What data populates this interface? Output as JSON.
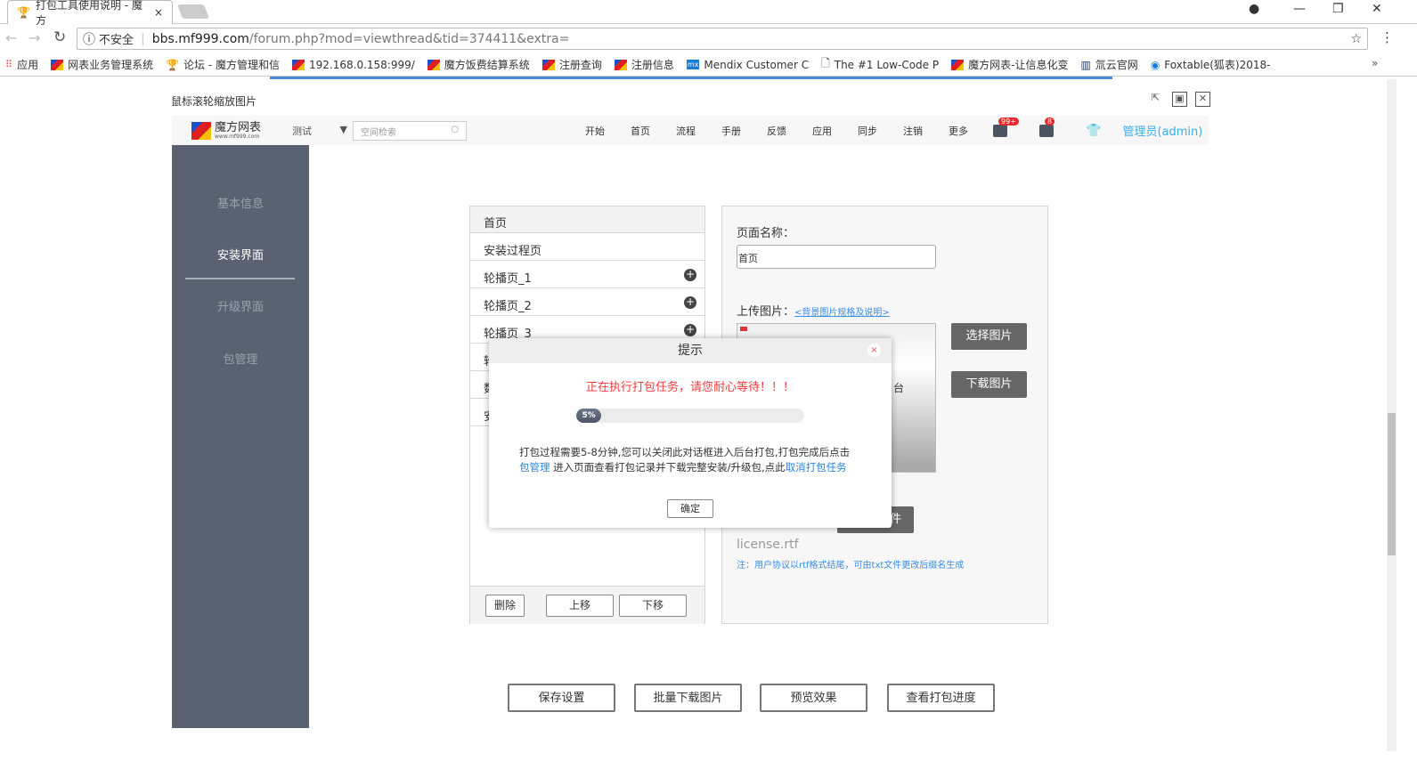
{
  "browser": {
    "tab_title": "打包工具使用说明 - 魔方",
    "security_label": "不安全",
    "url_domain": "bbs.mf999.com",
    "url_path": "/forum.php?mod=viewthread&tid=374411&extra=",
    "bookmarks": [
      "应用",
      "网表业务管理系统",
      "论坛 - 魔方管理和信",
      "192.168.0.158:999/",
      "魔方饭费结算系统",
      "注册查询",
      "注册信息",
      "Mendix Customer C",
      "The #1 Low-Code P",
      "魔方网表-让信息化变",
      "氚云官网",
      "Foxtable(狐表)2018-"
    ],
    "more": "»"
  },
  "page": {
    "hint": "鼠标滚轮缩放图片",
    "header": {
      "logo_title": "魔方网表",
      "logo_sub": "www.mf999.com",
      "select_value": "测试",
      "search_placeholder": "空间检索",
      "nav": [
        "开始",
        "首页",
        "流程",
        "手册",
        "反馈",
        "应用",
        "同步",
        "注销",
        "更多"
      ],
      "msg_badge": "99+",
      "task_badge": "8",
      "user": "管理员(admin)"
    },
    "sidebar": [
      {
        "label": "基本信息",
        "active": false
      },
      {
        "label": "安装界面",
        "active": true
      },
      {
        "label": "升级界面",
        "active": false
      },
      {
        "label": "包管理",
        "active": false
      }
    ],
    "list": {
      "header": "首页",
      "items": [
        "安装过程页",
        "轮播页_1",
        "轮播页_2",
        "轮播页_3",
        "轮",
        "数",
        "安"
      ],
      "buttons": {
        "delete": "删除",
        "up": "上移",
        "down": "下移"
      }
    },
    "form": {
      "page_name_label": "页面名称：",
      "page_name_value": "首页",
      "upload_label": "上传图片：",
      "spec_link": "<背景图片规格及说明>",
      "select_image": "选择图片",
      "download_image": "下载图片",
      "upload_file_partial": "件",
      "file_name": "license.rtf",
      "note": "注：用户协议以rtf格式结尾，可由txt文件更改后缀名生成",
      "preview_text": "台"
    },
    "bottom_buttons": [
      "保存设置",
      "批量下载图片",
      "预览效果",
      "查看打包进度"
    ],
    "dialog": {
      "title": "提示",
      "close": "×",
      "warning": "正在执行打包任务，请您耐心等待！！！",
      "progress_percent": 5,
      "progress_label": "5%",
      "text1": "打包过程需要5-8分钟,您可以关闭此对话框进入后台打包,打包完成后点击",
      "link1": "包管理",
      "text2": " 进入页面查看打包记录并下载完整安装/升级包,点此",
      "link2": "取消打包任务",
      "ok": "确定"
    }
  }
}
